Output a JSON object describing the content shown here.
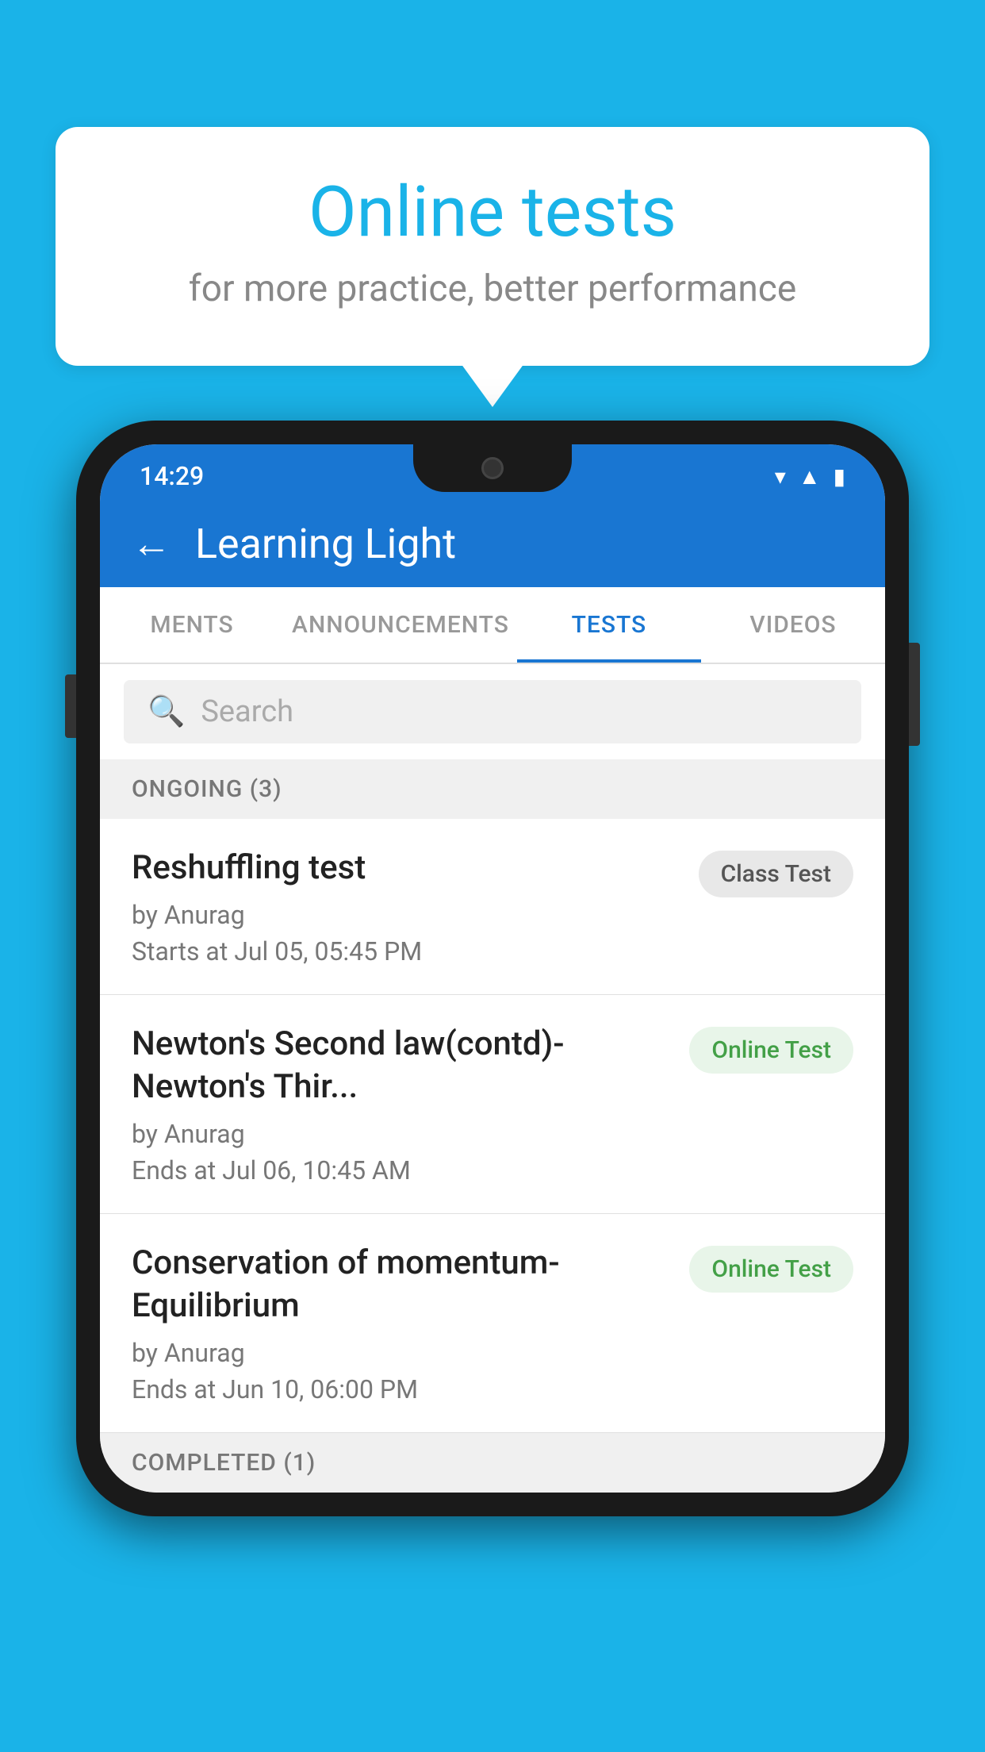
{
  "background_color": "#1ab3e8",
  "speech_bubble": {
    "title": "Online tests",
    "subtitle": "for more practice, better performance"
  },
  "phone": {
    "status_bar": {
      "time": "14:29",
      "icons": [
        "wifi",
        "signal",
        "battery"
      ]
    },
    "header": {
      "back_label": "←",
      "title": "Learning Light"
    },
    "tabs": [
      {
        "label": "MENTS",
        "active": false
      },
      {
        "label": "ANNOUNCEMENTS",
        "active": false
      },
      {
        "label": "TESTS",
        "active": true
      },
      {
        "label": "VIDEOS",
        "active": false
      }
    ],
    "search": {
      "placeholder": "Search"
    },
    "sections": [
      {
        "title": "ONGOING (3)",
        "items": [
          {
            "name": "Reshuffling test",
            "author": "by Anurag",
            "time_label": "Starts at",
            "time": "Jul 05, 05:45 PM",
            "badge": "Class Test",
            "badge_type": "class"
          },
          {
            "name": "Newton's Second law(contd)-Newton's Thir...",
            "author": "by Anurag",
            "time_label": "Ends at",
            "time": "Jul 06, 10:45 AM",
            "badge": "Online Test",
            "badge_type": "online"
          },
          {
            "name": "Conservation of momentum-Equilibrium",
            "author": "by Anurag",
            "time_label": "Ends at",
            "time": "Jun 10, 06:00 PM",
            "badge": "Online Test",
            "badge_type": "online"
          }
        ]
      }
    ],
    "bottom_section_label": "COMPLETED (1)"
  }
}
